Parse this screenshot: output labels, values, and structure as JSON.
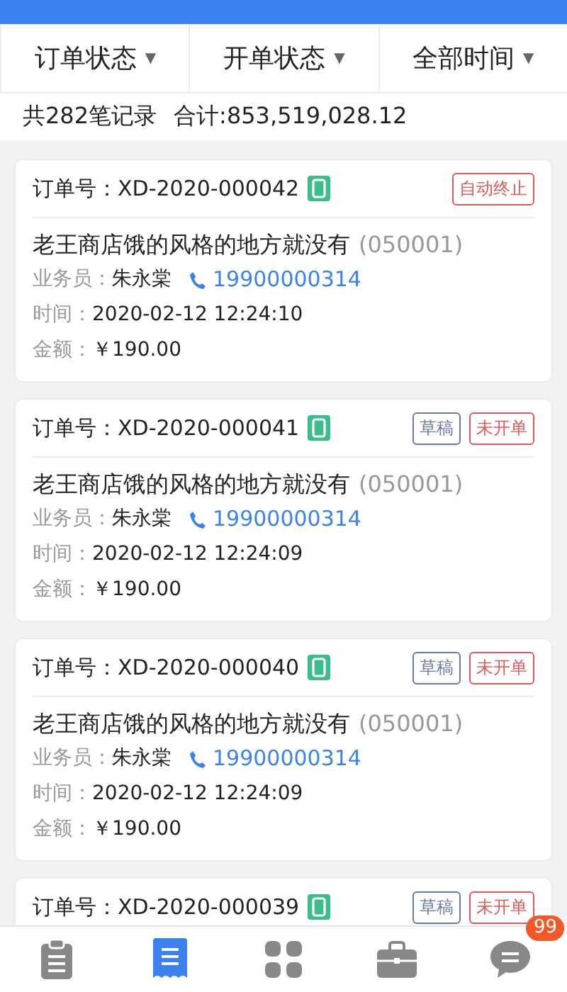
{
  "filters": [
    {
      "label": "订单状态",
      "arrow": "▼"
    },
    {
      "label": "开单状态",
      "arrow": "▼"
    },
    {
      "label": "全部时间",
      "arrow": "▼"
    }
  ],
  "summary": {
    "count": "共282笔记录",
    "total": "合计:853,519,028.12"
  },
  "orders": [
    {
      "number": "订单号：XD-2020-000042",
      "tags": [
        {
          "label": "自动终止",
          "color": "#e05a5a"
        }
      ],
      "store": "老王商店饿的风格的地方就没有",
      "store_code": "(050001)",
      "salesman_label": "业务员：",
      "salesman": "朱永棠",
      "phone": "19900000314",
      "time_label": "时间：",
      "time": "2020-02-12 12:24:10",
      "amount_label": "金额：",
      "amount": "￥190.00"
    },
    {
      "number": "订单号：XD-2020-000041",
      "tags": [
        {
          "label": "草稿",
          "color": "#6a7aa8"
        },
        {
          "label": "未开单",
          "color": "#e05a5a"
        }
      ],
      "store": "老王商店饿的风格的地方就没有",
      "store_code": "(050001)",
      "salesman_label": "业务员：",
      "salesman": "朱永棠",
      "phone": "19900000314",
      "time_label": "时间：",
      "time": "2020-02-12 12:24:09",
      "amount_label": "金额：",
      "amount": "￥190.00"
    },
    {
      "number": "订单号：XD-2020-000040",
      "tags": [
        {
          "label": "草稿",
          "color": "#6a7aa8"
        },
        {
          "label": "未开单",
          "color": "#e05a5a"
        }
      ],
      "store": "老王商店饿的风格的地方就没有",
      "store_code": "(050001)",
      "salesman_label": "业务员：",
      "salesman": "朱永棠",
      "phone": "19900000314",
      "time_label": "时间：",
      "time": "2020-02-12 12:24:09",
      "amount_label": "金额：",
      "amount": "￥190.00"
    },
    {
      "number": "订单号：XD-2020-000039",
      "tags": [
        {
          "label": "草稿",
          "color": "#6a7aa8"
        },
        {
          "label": "未开单",
          "color": "#e05a5a"
        }
      ]
    }
  ],
  "tabs": [
    {
      "kind": "clipboard",
      "selected": false
    },
    {
      "kind": "receipt",
      "selected": true
    },
    {
      "kind": "grid",
      "selected": false
    },
    {
      "kind": "briefcase",
      "selected": false
    },
    {
      "kind": "chat",
      "selected": false,
      "badge": "99"
    }
  ]
}
